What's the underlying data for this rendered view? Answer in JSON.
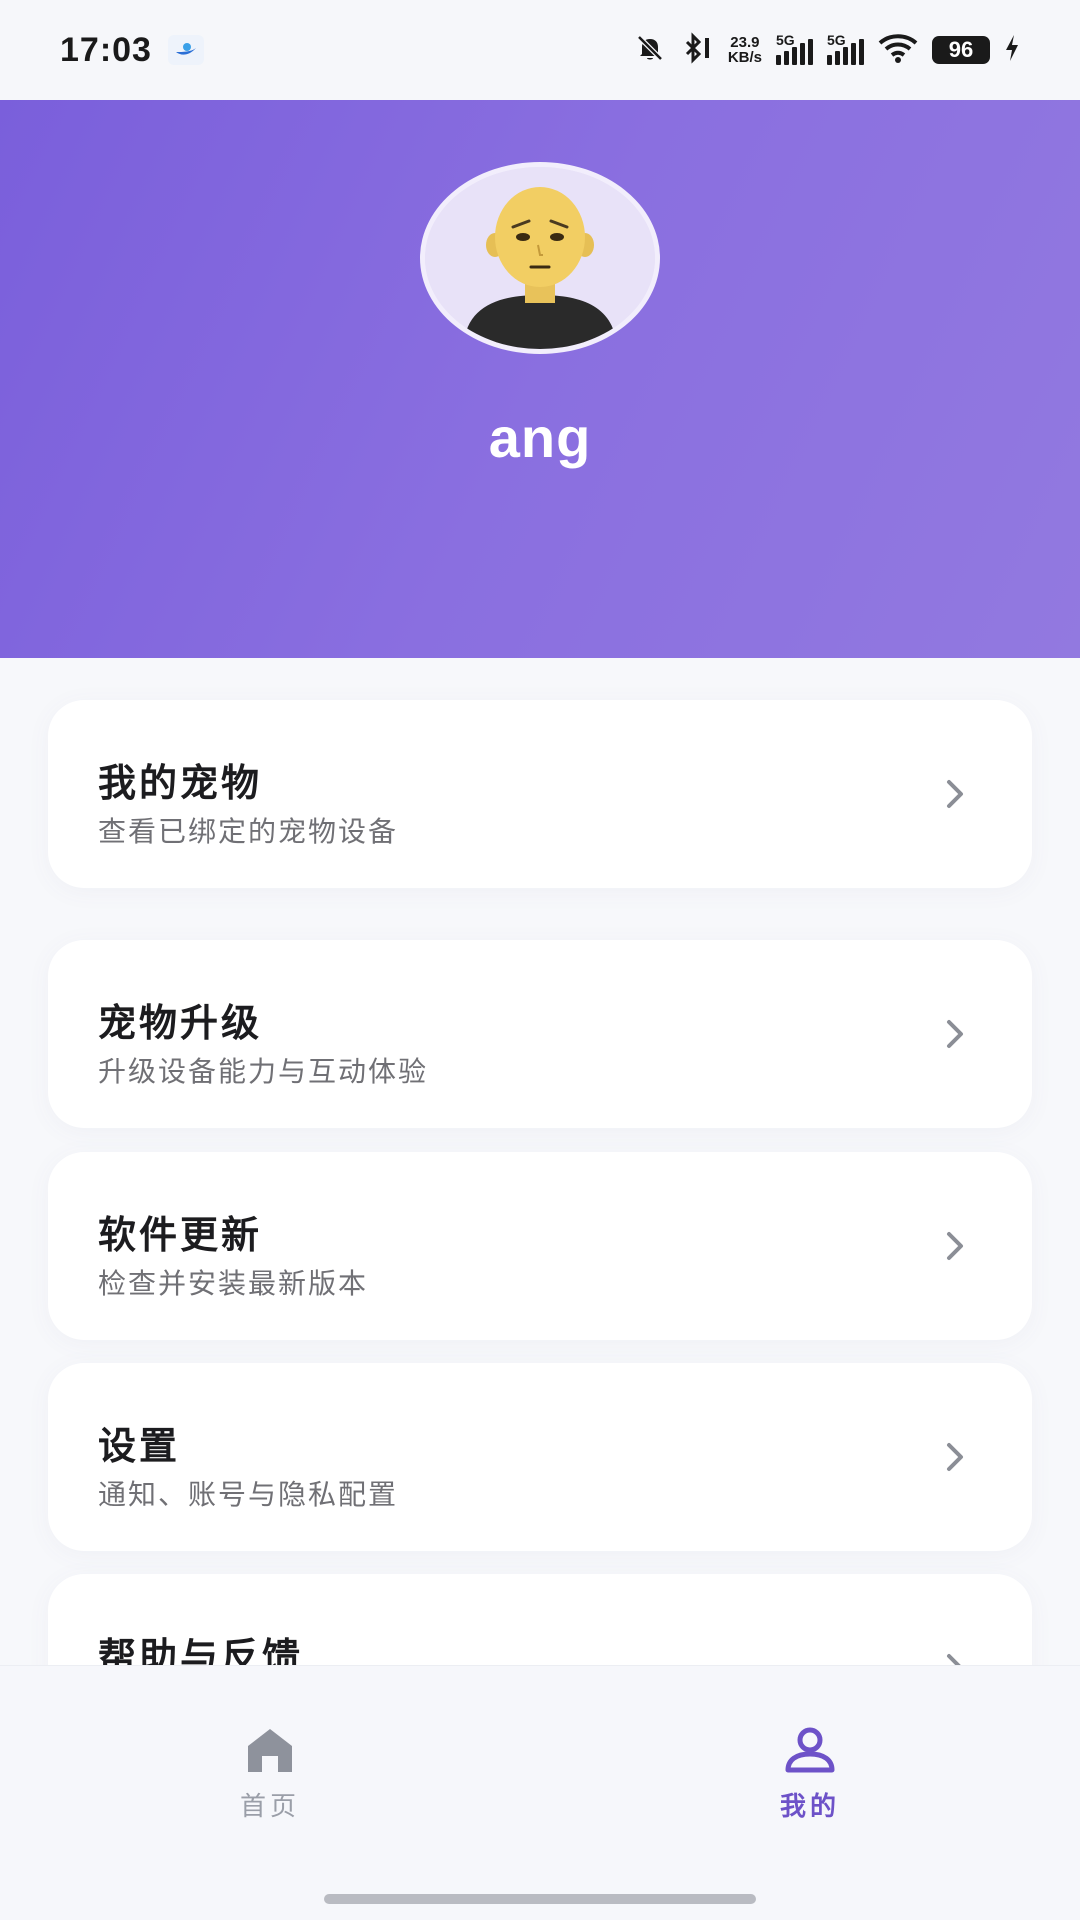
{
  "status_bar": {
    "time": "17:03",
    "net_speed_value": "23.9",
    "net_speed_unit": "KB/s",
    "sim1_type": "5G",
    "sim2_type": "5G",
    "battery": "96",
    "icons": [
      "app-notification-icon",
      "mute-bell-icon",
      "bluetooth-icon",
      "signal-icon",
      "wifi-icon",
      "battery-icon",
      "charging-icon"
    ]
  },
  "profile": {
    "username": "ang"
  },
  "menu": [
    {
      "title": "我的宠物",
      "subtitle": "查看已绑定的宠物设备"
    },
    {
      "title": "宠物升级",
      "subtitle": "升级设备能力与互动体验"
    },
    {
      "title": "软件更新",
      "subtitle": "检查并安装最新版本"
    },
    {
      "title": "设置",
      "subtitle": "通知、账号与隐私配置"
    },
    {
      "title": "帮助与反馈",
      "subtitle": ""
    }
  ],
  "bottom_nav": {
    "home_label": "首页",
    "mine_label": "我的",
    "active": "mine"
  },
  "colors": {
    "header_gradient_start": "#7a5fdb",
    "header_gradient_end": "#9279e0",
    "accent": "#6d52c8",
    "inactive": "#9a9ea8"
  }
}
